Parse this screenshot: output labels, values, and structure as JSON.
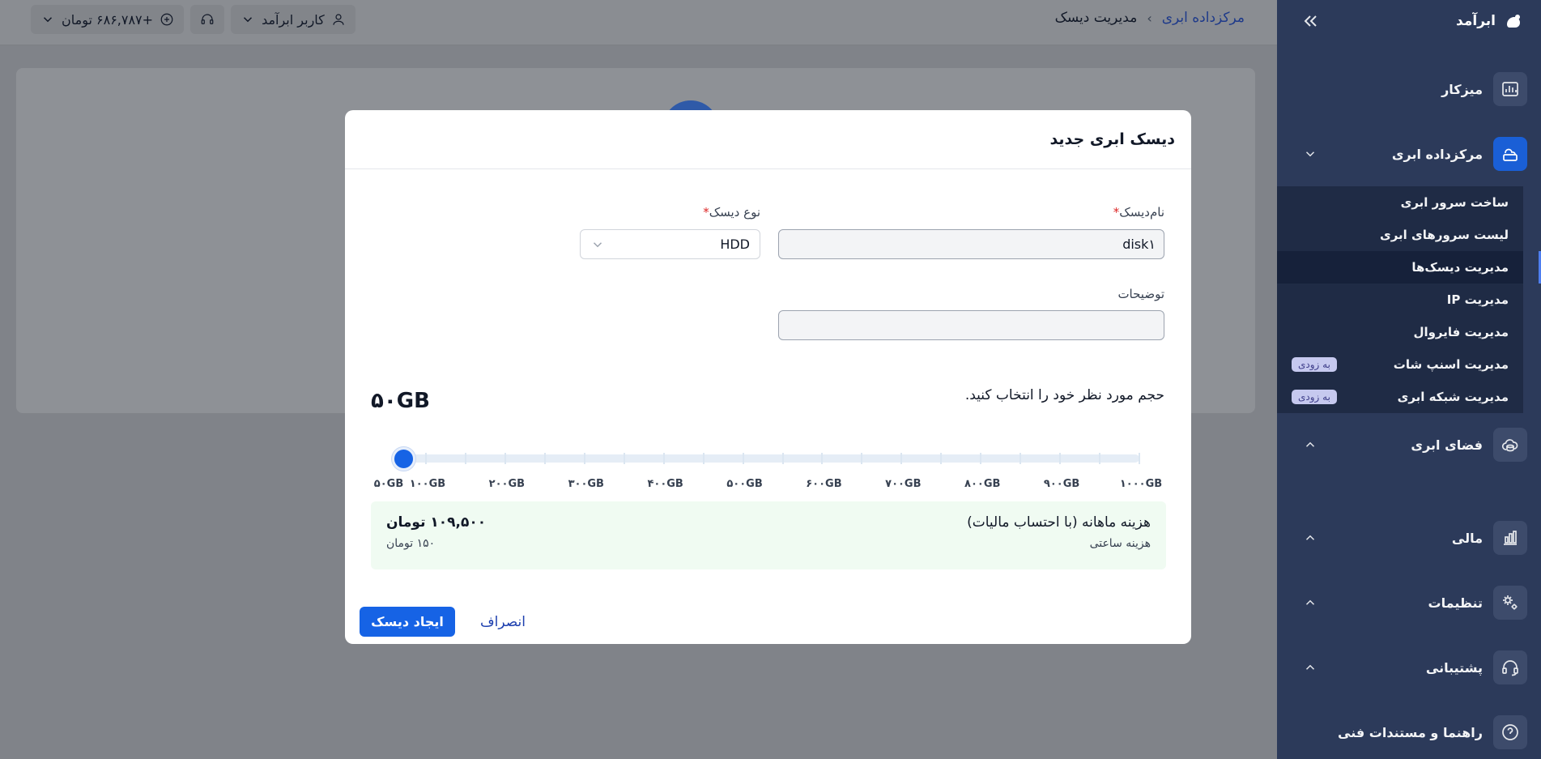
{
  "topbar": {
    "breadcrumb_root": "مرکزداده ابری",
    "breadcrumb_sep": "›",
    "breadcrumb_current": "مدیریت دیسک",
    "balance": "+۶۸۶,۷۸۷ تومان",
    "user": "کاربر ابرآمد"
  },
  "sidebar": {
    "brand": "ابرآمد",
    "items": [
      {
        "label": "میزکار",
        "icon": "dashboard-chart-icon"
      },
      {
        "label": "مرکزداده ابری",
        "icon": "cloud-datacenter-icon"
      },
      {
        "label": "فضای ابری",
        "icon": "cloud-storage-icon"
      },
      {
        "label": "مالی",
        "icon": "finance-chart-icon"
      },
      {
        "label": "تنظیمات",
        "icon": "gears-icon"
      },
      {
        "label": "پشتیبانی",
        "icon": "headset-icon"
      },
      {
        "label": "راهنما و مستندات فنی",
        "icon": "help-icon"
      }
    ],
    "submenu": [
      {
        "label": "ساخت سرور ابری",
        "badge": ""
      },
      {
        "label": "لیست سرورهای ابری",
        "badge": ""
      },
      {
        "label": "مدیریت دیسک‌ها",
        "badge": ""
      },
      {
        "label": "مدیریت IP",
        "badge": ""
      },
      {
        "label": "مدیریت فایروال",
        "badge": ""
      },
      {
        "label": "مدیریت اسنپ شات",
        "badge": "به زودی"
      },
      {
        "label": "مدیریت شبکه ابری",
        "badge": "به زودی"
      }
    ]
  },
  "modal": {
    "title": "دیسک ابری جدید",
    "disk_name_label": "نام‌دیسک",
    "disk_name_value": "disk۱",
    "disk_type_label": "نوع دیسک",
    "disk_type_value": "HDD",
    "description_label": "توضیحات",
    "description_value": "",
    "required_mark": "*",
    "size_prompt": "حجم مورد نظر خود را انتخاب کنید.",
    "size_value": "۵۰GB",
    "slider": {
      "selected_fraction": 0.0,
      "ticks": [
        "۵۰GB",
        "۱۰۰GB",
        "۲۰۰GB",
        "۳۰۰GB",
        "۴۰۰GB",
        "۵۰۰GB",
        "۶۰۰GB",
        "۷۰۰GB",
        "۸۰۰GB",
        "۹۰۰GB",
        "۱۰۰۰GB"
      ]
    },
    "cost_title": "هزینه ماهانه (با احتساب مالیات)",
    "cost_sub": "هزینه ساعتی",
    "cost_monthly": "۱۰۹,۵۰۰ تومان",
    "cost_hourly": "۱۵۰ تومان",
    "create_button": "ایجاد دیسک",
    "cancel_button": "انصراف"
  },
  "colors": {
    "primary": "#1663e5",
    "sidebar_bg": "#2c3a5a",
    "submenu_bg": "#1f2b45",
    "badge_bg": "#c6c9ef",
    "cost_bg": "#f0fbf2",
    "required": "#dc2626"
  }
}
